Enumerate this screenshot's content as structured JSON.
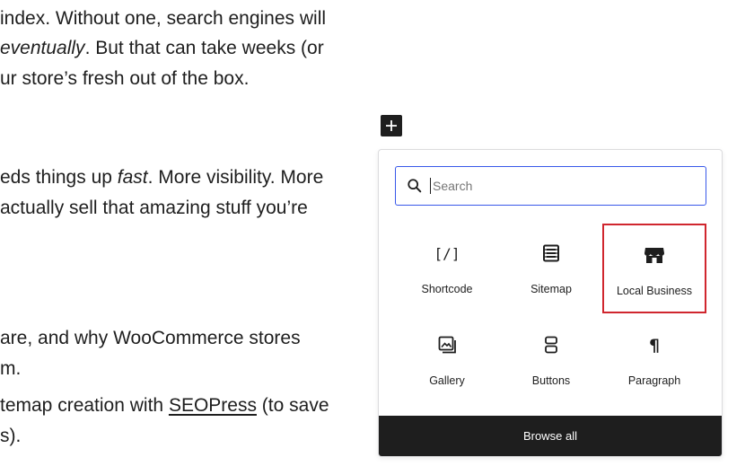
{
  "article": {
    "line1": "index. Without one, search engines will",
    "line2_em": "eventually",
    "line2_rest": ". But that can take weeks (or",
    "line3": "ur store’s fresh out of the box.",
    "line4_a": "eds things up ",
    "line4_em": "fast",
    "line4_b": ". More visibility. More",
    "line5": "actually sell that amazing stuff you’re",
    "line6": "are, and why WooCommerce stores",
    "line7": "m.",
    "line8_a": "temap creation with ",
    "line8_link": "SEOPress",
    "line8_b": " (to save",
    "line9": "s)."
  },
  "inserter": {
    "search_placeholder": "Search",
    "blocks": [
      {
        "label": "Shortcode",
        "icon": "shortcode-icon"
      },
      {
        "label": "Sitemap",
        "icon": "sitemap-icon"
      },
      {
        "label": "Local Business",
        "icon": "store-icon"
      },
      {
        "label": "Gallery",
        "icon": "gallery-icon"
      },
      {
        "label": "Buttons",
        "icon": "buttons-icon"
      },
      {
        "label": "Paragraph",
        "icon": "paragraph-icon"
      }
    ],
    "browse_all": "Browse all"
  },
  "colors": {
    "accent": "#3858e9",
    "highlight": "#d0262e",
    "dark": "#1e1e1e"
  }
}
